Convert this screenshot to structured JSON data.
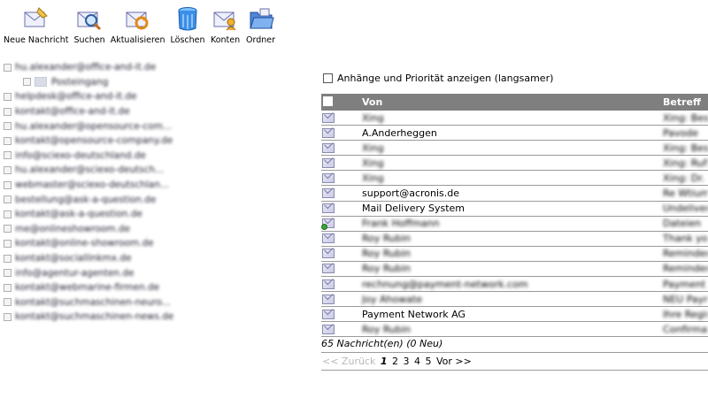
{
  "toolbar": {
    "buttons": [
      {
        "label": "Neue Nachricht",
        "icon": "new-message-icon"
      },
      {
        "label": "Suchen",
        "icon": "search-icon"
      },
      {
        "label": "Aktualisieren",
        "icon": "refresh-icon"
      },
      {
        "label": "Löschen",
        "icon": "trash-icon"
      },
      {
        "label": "Konten",
        "icon": "accounts-icon"
      },
      {
        "label": "Ordner",
        "icon": "folder-icon"
      }
    ]
  },
  "tree": {
    "items": [
      "hu.alexander@office-and-it.de",
      "Posteingang",
      "helpdesk@office-and-it.de",
      "kontakt@office-and-it.de",
      "hu.alexander@opensource-com...",
      "kontakt@opensource-company.de",
      "info@sciexo-deutschland.de",
      "hu.alexander@sciexo-deutsch...",
      "webmaster@sciexo-deutschlan...",
      "bestellung@ask-a-question.de",
      "kontakt@ask-a-question.de",
      "me@onlineshowroom.de",
      "kontakt@online-showroom.de",
      "kontakt@sociallinkmx.de",
      "info@agentur-agenten.de",
      "kontakt@webmarine-firmen.de",
      "kontakt@suchmaschinen-neuro...",
      "kontakt@suchmaschinen-news.de"
    ]
  },
  "options": {
    "show_attachments_label": "Anhänge und Priorität anzeigen (langsamer)"
  },
  "table": {
    "col_from": "Von",
    "col_subject": "Betreff",
    "rows": [
      {
        "from": "Xing",
        "subject": "Xing: Besu",
        "blur": true
      },
      {
        "from": "A.Anderheggen",
        "subject": "Pavode",
        "blur": false
      },
      {
        "from": "Xing",
        "subject": "Xing: Besu",
        "blur": true
      },
      {
        "from": "Xing",
        "subject": "Xing: Rufk",
        "blur": true
      },
      {
        "from": "Xing",
        "subject": "Xing: Dr. E",
        "blur": true
      },
      {
        "from": "support@acronis.de",
        "subject": "Re Wtium",
        "blur": false
      },
      {
        "from": "Mail Delivery System",
        "subject": "Undeliver",
        "blur": false
      },
      {
        "from": "Frank Hoffmann",
        "subject": "Dateien",
        "blur": true
      },
      {
        "from": "Roy Rubin",
        "subject": "Thank you",
        "blur": true
      },
      {
        "from": "Roy Rubin",
        "subject": "Reminder",
        "blur": true
      },
      {
        "from": "Roy Rubin",
        "subject": "Reminder",
        "blur": true
      },
      {
        "from": "rechnung@payment-network.com",
        "subject": "Payment",
        "blur": true
      },
      {
        "from": "Joy Ahowate",
        "subject": "NEU Payn",
        "blur": true
      },
      {
        "from": "Payment Network AG",
        "subject": "Ihre Regis",
        "blur": false
      },
      {
        "from": "Roy Rubin",
        "subject": "Confirmat",
        "blur": true
      }
    ]
  },
  "footer": {
    "count": "65 Nachricht(en)   (0 Neu)",
    "back": "<< Zurück",
    "pages": [
      "1",
      "2",
      "3",
      "4",
      "5"
    ],
    "next": "Vor >>"
  },
  "colors": {
    "header_bg": "#7f7f7f",
    "row_border": "#9a9a9a",
    "unread_dot": "#3aa53a"
  }
}
